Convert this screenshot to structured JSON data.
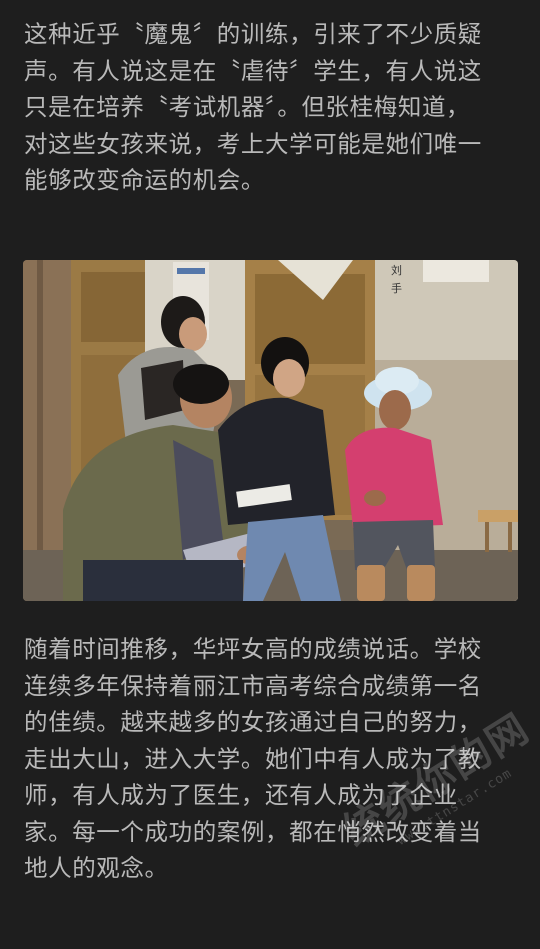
{
  "article": {
    "paragraph_1": [
      "这种近乎〝魔鬼〞的训练，引来了不少质疑",
      "声。有人说这是在〝虐待〞学生，有人说这",
      "只是在培养〝考试机器〞。但张桂梅知道，",
      "对这些女孩来说，考上大学可能是她们唯一",
      "能够改变命运的机会。"
    ],
    "photo": {
      "alt": "",
      "door_labels": [
        "刘",
        "手"
      ]
    },
    "paragraph_2": [
      "随着时间推移，华坪女高的成绩说话。学校",
      "连续多年保持着丽江市高考综合成绩第一名",
      "的佳绩。越来越多的女孩通过自己的努力，",
      "走出大山，进入大学。她们中有人成为了教",
      "师，有人成为了医生，还有人成为了企业",
      "家。每一个成功的案例，都在悄然改变着当",
      "地人的观念。"
    ]
  },
  "watermark": {
    "main": "统统你的网",
    "sub": "www.ttnstar.com"
  },
  "colors": {
    "background": "#1e1e1e",
    "text": "#b9b9b9"
  }
}
